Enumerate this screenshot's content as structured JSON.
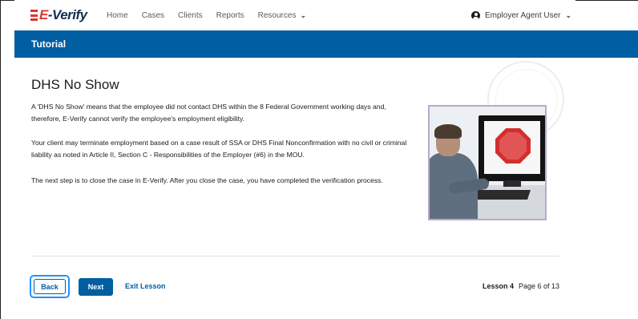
{
  "nav": {
    "logo": {
      "prefix": "E",
      "rest": "-Verify"
    },
    "items": [
      {
        "label": "Home"
      },
      {
        "label": "Cases"
      },
      {
        "label": "Clients"
      },
      {
        "label": "Reports"
      },
      {
        "label": "Resources"
      }
    ],
    "user_label": "Employer Agent User"
  },
  "banner": {
    "title": "Tutorial"
  },
  "content": {
    "heading": "DHS No Show",
    "paragraphs": [
      "A 'DHS No Show' means that the employee did not contact DHS within the 8 Federal Government working days and, therefore, E-Verify cannot verify the employee's employment eligibility.",
      "Your client may terminate employment based on a case result of SSA or DHS Final Nonconfirmation with no civil or criminal liability as noted in Article II, Section C - Responsibilities of the Employer (#6) in the MOU.",
      "The next step is to close the case in E-Verify. After you close the case, you have completed the verification process."
    ]
  },
  "footer": {
    "back_label": "Back",
    "next_label": "Next",
    "exit_label": "Exit Lesson",
    "lesson_label": "Lesson 4",
    "page_label": "Page 6 of 13"
  },
  "colors": {
    "primary": "#005ea2",
    "focus": "#2491ff",
    "logo_red": "#d83933",
    "logo_navy": "#162e51"
  }
}
